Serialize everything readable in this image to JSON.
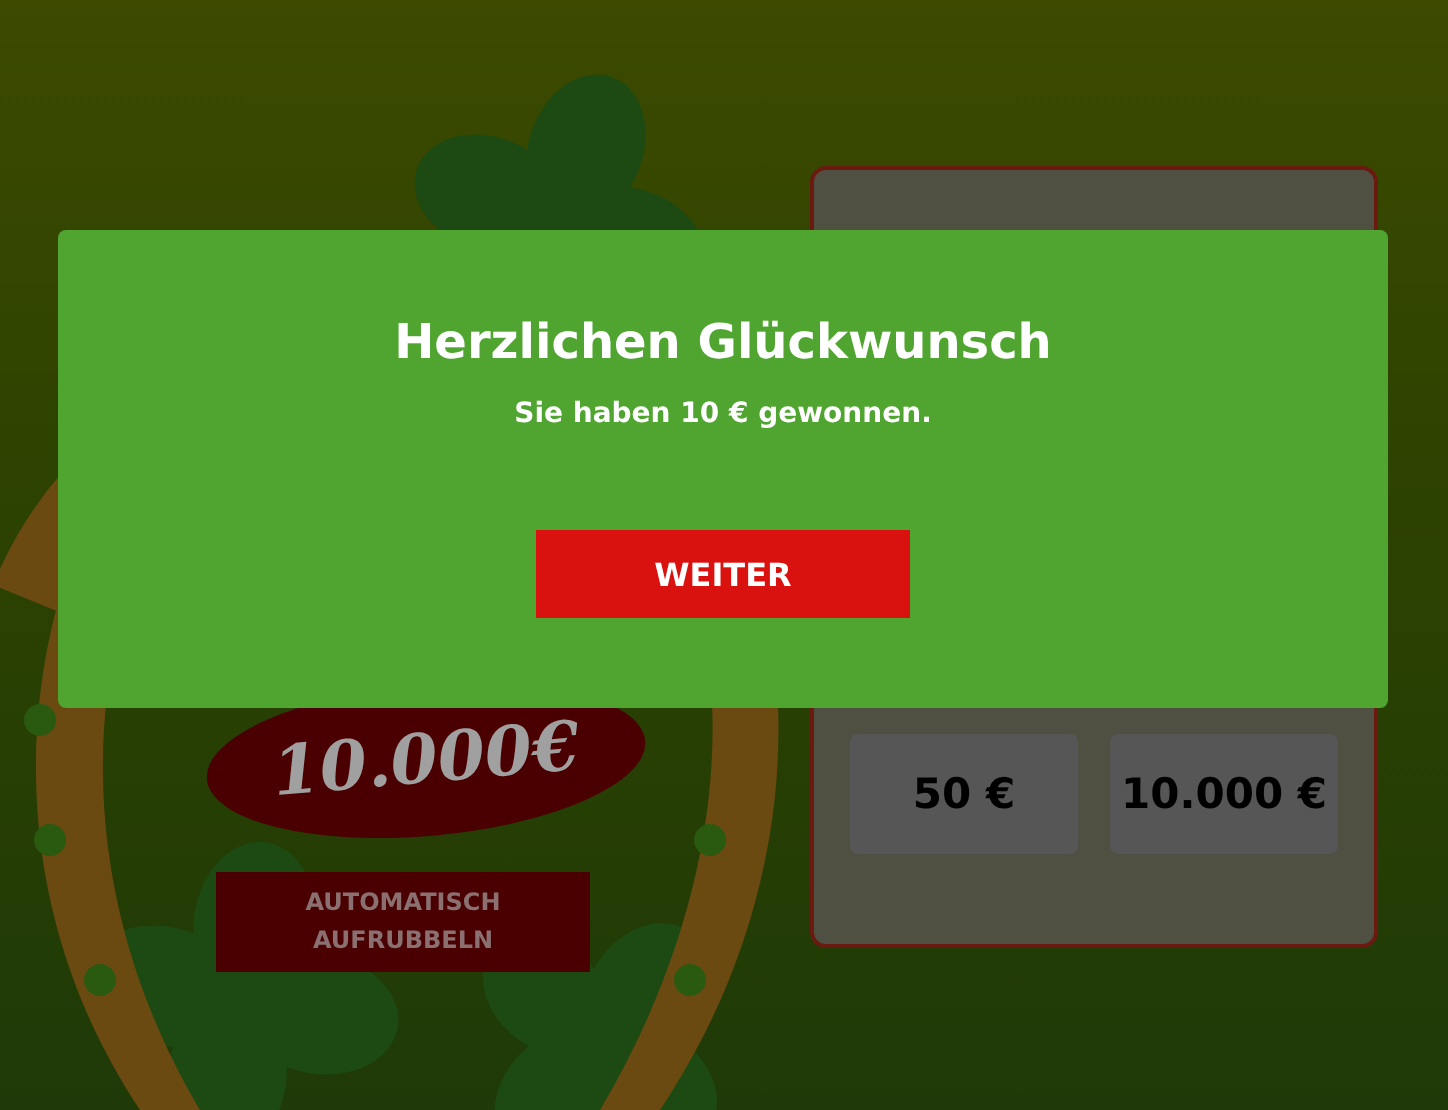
{
  "game": {
    "jackpot": "10.000€",
    "auto_button": "AUTOMATISCH AUFRUBBELN",
    "prizes": [
      "50 €",
      "10.000 €"
    ]
  },
  "dialog": {
    "title": "Herzlichen Glückwunsch",
    "message": "Sie haben 10 € gewonnen.",
    "button": "WEITER"
  }
}
